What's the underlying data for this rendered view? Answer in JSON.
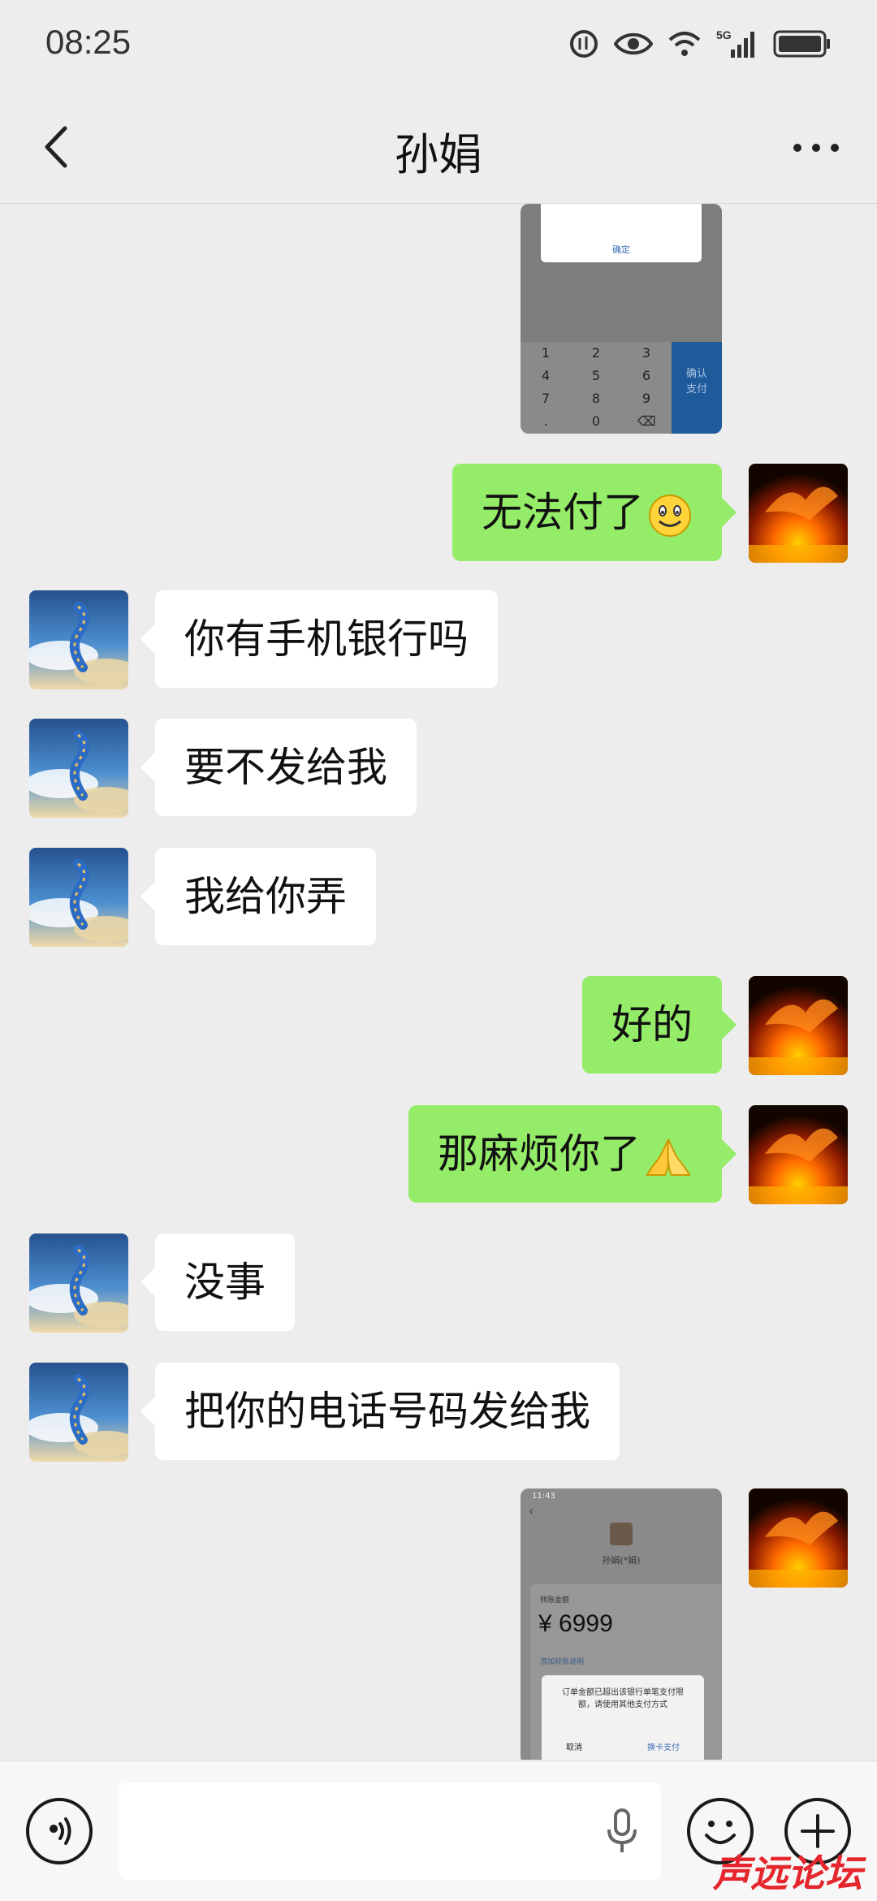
{
  "status_bar": {
    "time": "08:25",
    "network": "5G"
  },
  "header": {
    "title": "孙娟"
  },
  "messages": [
    {
      "side": "out",
      "type": "image",
      "content": "payment-screenshot-keypad",
      "texts": {
        "confirm": "确定",
        "keys": [
          "1",
          "2",
          "3",
          "4",
          "5",
          "6",
          "7",
          "8",
          "9",
          ".",
          "0"
        ],
        "side_button": "确认\n支付"
      }
    },
    {
      "side": "out",
      "type": "text",
      "text": "无法付了",
      "emoji": "smiley-emoji"
    },
    {
      "side": "in",
      "type": "text",
      "text": "你有手机银行吗"
    },
    {
      "side": "in",
      "type": "text",
      "text": "要不发给我"
    },
    {
      "side": "in",
      "type": "text",
      "text": "我给你弄"
    },
    {
      "side": "out",
      "type": "text",
      "text": "好的"
    },
    {
      "side": "out",
      "type": "text",
      "text": "那麻烦你了",
      "emoji": "folded-hands-emoji"
    },
    {
      "side": "in",
      "type": "text",
      "text": "没事"
    },
    {
      "side": "in",
      "type": "text",
      "text": "把你的电话号码发给我"
    },
    {
      "side": "out",
      "type": "image",
      "content": "transfer-screenshot",
      "texts": {
        "time": "11:43",
        "name": "孙娟(*娟)",
        "amount_label": "转账金额",
        "amount": "¥ 6999",
        "note": "添加转账说明",
        "dialog": "订单金额已超出该银行单笔支付限额，请使用其他支付方式",
        "cancel": "取消",
        "switch": "换卡支付"
      }
    }
  ],
  "bottom_bar": {
    "watermark": "声远论坛"
  }
}
